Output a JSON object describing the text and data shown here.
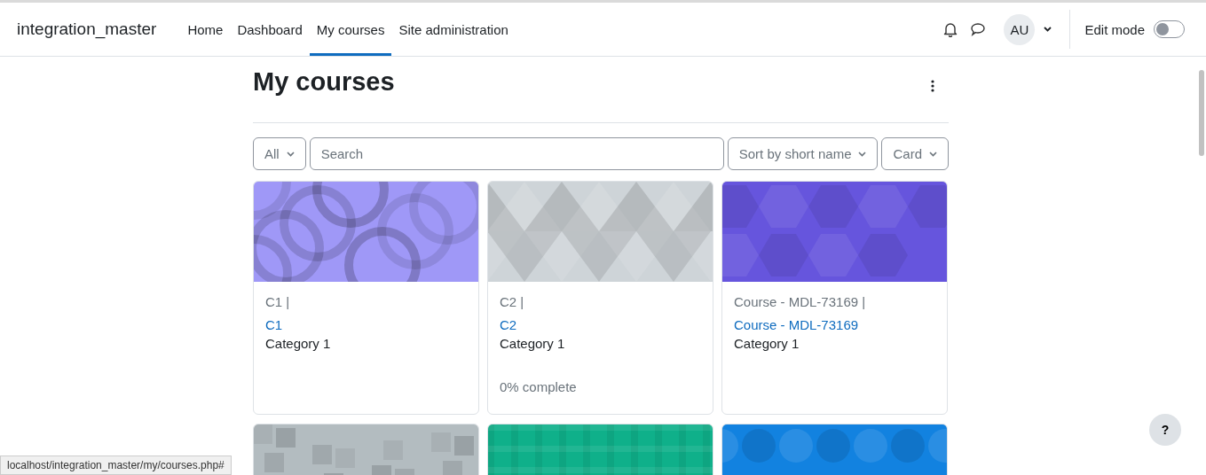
{
  "site_name": "integration_master",
  "nav": [
    {
      "label": "Home",
      "selected": false
    },
    {
      "label": "Dashboard",
      "selected": false
    },
    {
      "label": "My courses",
      "selected": true
    },
    {
      "label": "Site administration",
      "selected": false
    }
  ],
  "user": {
    "initials": "AU"
  },
  "edit_mode": {
    "label": "Edit mode",
    "on": false
  },
  "page_title": "My courses",
  "filters": {
    "grouping": "All",
    "search": {
      "placeholder": "Search"
    },
    "sort": "Sort by short name",
    "view": "Card"
  },
  "courses": [
    {
      "shortname": "C1 |",
      "fullname": "C1",
      "category": "Category 1",
      "kind": "circles",
      "color": "#9f98f7"
    },
    {
      "shortname": "C2 |",
      "fullname": "C2",
      "category": "Category 1",
      "progress": "0% complete",
      "kind": "triangles",
      "color": "#ced4d8"
    },
    {
      "shortname": "Course - MDL-73169 |",
      "fullname": "Course - MDL-73169",
      "category": "Category 1",
      "kind": "hexagons",
      "color": "#6655dd"
    },
    {
      "kind": "squares",
      "color": "#b3bcc0"
    },
    {
      "kind": "plaid",
      "color": "#0fb08a"
    },
    {
      "kind": "octagons",
      "color": "#1282e0"
    }
  ],
  "help": "?",
  "status_url": "localhost/integration_master/my/courses.php#"
}
